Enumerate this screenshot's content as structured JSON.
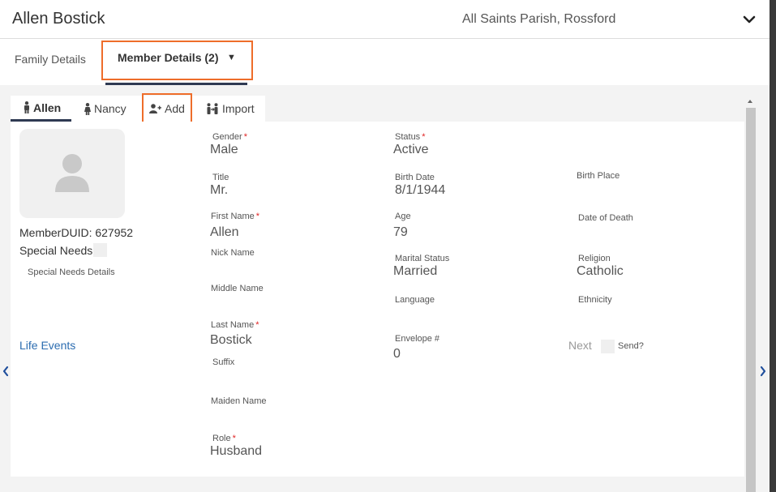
{
  "header": {
    "member_name": "Allen Bostick",
    "parish": "All Saints Parish, Rossford"
  },
  "tabs": {
    "family": "Family Details",
    "member": "Member Details (2)",
    "member_caret": "▼"
  },
  "subtabs": {
    "allen": "Allen",
    "nancy": "Nancy",
    "add": "Add",
    "import": "Import"
  },
  "left": {
    "duid": "MemberDUID: 627952",
    "special_needs": "Special Needs",
    "special_needs_details": "Special Needs Details",
    "life_events": "Life Events"
  },
  "fields": {
    "gender": {
      "label": "Gender",
      "value": "Male"
    },
    "status": {
      "label": "Status",
      "value": "Active"
    },
    "title": {
      "label": "Title",
      "value": "Mr."
    },
    "birth_date": {
      "label": "Birth Date",
      "value": "8/1/1944"
    },
    "birth_place": {
      "label": "Birth Place",
      "value": ""
    },
    "first_name": {
      "label": "First Name",
      "value": "Allen"
    },
    "age": {
      "label": "Age",
      "value": "79"
    },
    "date_of_death": {
      "label": "Date of Death",
      "value": ""
    },
    "nick_name": {
      "label": "Nick Name",
      "value": ""
    },
    "marital_status": {
      "label": "Marital Status",
      "value": "Married"
    },
    "religion": {
      "label": "Religion",
      "value": "Catholic"
    },
    "middle_name": {
      "label": "Middle Name",
      "value": ""
    },
    "language": {
      "label": "Language",
      "value": ""
    },
    "ethnicity": {
      "label": "Ethnicity",
      "value": ""
    },
    "last_name": {
      "label": "Last Name",
      "value": "Bostick"
    },
    "envelope": {
      "label": "Envelope #",
      "value": "0"
    },
    "suffix": {
      "label": "Suffix",
      "value": ""
    },
    "maiden_name": {
      "label": "Maiden Name",
      "value": ""
    },
    "role": {
      "label": "Role",
      "value": "Husband"
    }
  },
  "required_mark": "*",
  "next_send": {
    "next": "Next",
    "send": "Send?"
  },
  "colors": {
    "accent_border": "#ee6d2a",
    "tab_underline": "#2f3a52",
    "link": "#2b6cb0",
    "required": "#e02424"
  }
}
